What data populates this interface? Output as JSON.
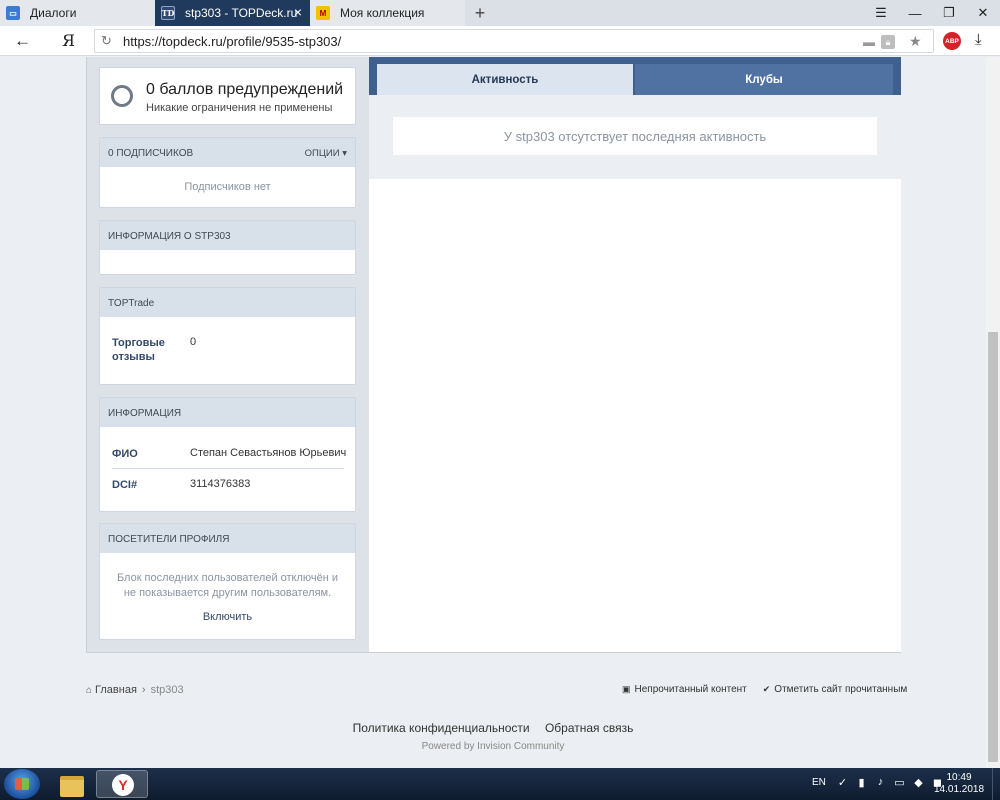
{
  "browser": {
    "tabs": [
      {
        "label": "Диалоги",
        "favicon": "message-icon"
      },
      {
        "label": "stp303 - TOPDeck.ru",
        "favicon": "TD",
        "active": true
      },
      {
        "label": "Моя коллекция",
        "favicon": "collection-icon"
      }
    ],
    "new_tab": "+",
    "yandex_button": "Я",
    "url": "https://topdeck.ru/profile/9535-stp303/",
    "abp_label": "ABP"
  },
  "sidebar": {
    "warnings": {
      "title": "0 баллов предупреждений",
      "subtitle": "Никакие ограничения не применены"
    },
    "subscribers": {
      "header": "0 подписчиков",
      "options": "Опции",
      "empty": "Подписчиков нет"
    },
    "about": {
      "header": "Информация о stp303"
    },
    "toptrade": {
      "header": "TOPTrade",
      "label": "Торговые отзывы",
      "value": "0"
    },
    "info": {
      "header": "Информация",
      "fields": [
        {
          "label": "ФИО",
          "value": "Степан Севастьянов Юрьевич"
        },
        {
          "label": "DCI#",
          "value": "3114376383"
        }
      ]
    },
    "visitors": {
      "header": "Посетители профиля",
      "message": "Блок последних пользователей отключён и не показывается другим пользователям.",
      "enable": "Включить"
    }
  },
  "main": {
    "tabs": [
      {
        "label": "Активность",
        "active": true
      },
      {
        "label": "Клубы"
      }
    ],
    "activity_empty": "У stp303 отсутствует последняя активность"
  },
  "footer": {
    "breadcrumb": [
      "Главная",
      "stp303"
    ],
    "unread": "Непрочитанный контент",
    "mark_read": "Отметить сайт прочитанным",
    "links": [
      "Политика конфиденциальности",
      "Обратная связь"
    ],
    "powered": "Powered by Invision Community"
  },
  "taskbar": {
    "lang": "EN",
    "time": "10:49",
    "date": "14.01.2018",
    "yandex_letter": "Y"
  },
  "colors": {
    "accent": "#3f5f8c",
    "panel_header": "#d8e0ea",
    "link": "#34496a",
    "abp_red": "#d2232a"
  }
}
